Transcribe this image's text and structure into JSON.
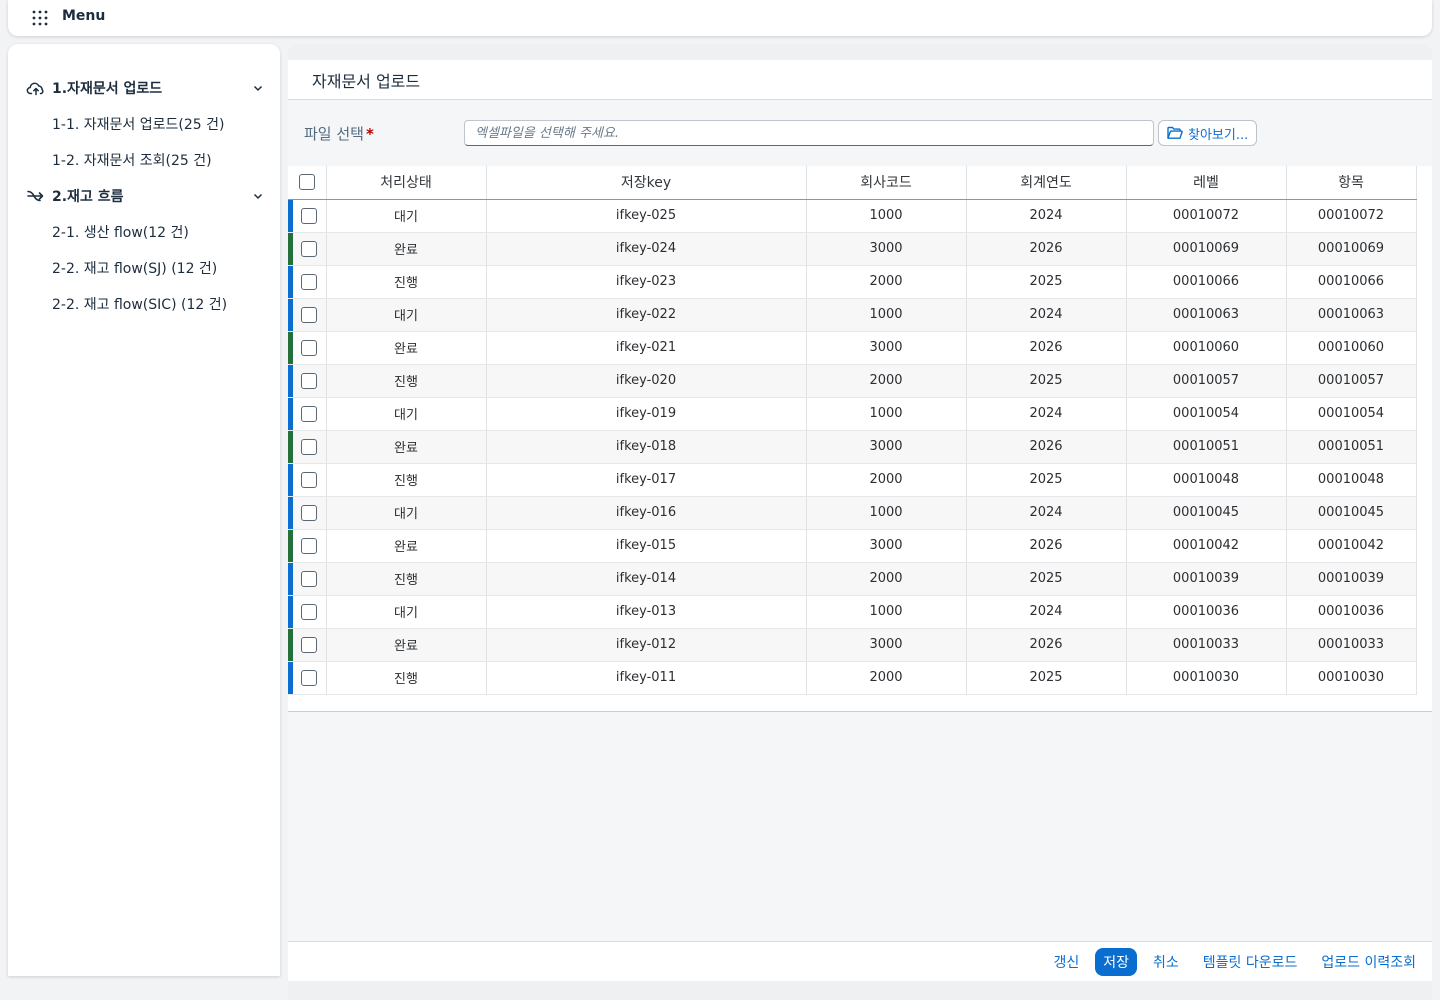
{
  "shell": {
    "menu_label": "Menu"
  },
  "sidebar": {
    "groups": [
      {
        "label": "1.자재문서 업로드",
        "icon": "cloud-upload-icon",
        "items": [
          {
            "label": "1-1. 자재문서 업로드(25 건)"
          },
          {
            "label": "1-2. 자재문서 조회(25 건)"
          }
        ]
      },
      {
        "label": "2.재고 흐름",
        "icon": "flow-arrow-icon",
        "items": [
          {
            "label": "2-1. 생산 flow(12 건)"
          },
          {
            "label": "2-2. 재고 flow(SJ) (12 건)"
          },
          {
            "label": "2-2. 재고 flow(SIC) (12 건)"
          }
        ]
      }
    ]
  },
  "main": {
    "title": "자재문서 업로드",
    "file_label": "파일 선택",
    "file_placeholder": "엑셀파일을 선택해 주세요.",
    "file_value": "",
    "browse_label": "찾아보기..."
  },
  "colors": {
    "accent": "#0a6ed1",
    "stripe_waiting": "#0a6ed1",
    "stripe_done": "#256f3a",
    "stripe_progress": "#0a6ed1"
  },
  "table": {
    "headers": [
      "처리상태",
      "저장key",
      "회사코드",
      "회계연도",
      "레벨",
      "항목"
    ],
    "rows": [
      {
        "status": "대기",
        "key": "ifkey-025",
        "company": "1000",
        "year": "2024",
        "level": "00010072",
        "item": "00010072"
      },
      {
        "status": "완료",
        "key": "ifkey-024",
        "company": "3000",
        "year": "2026",
        "level": "00010069",
        "item": "00010069"
      },
      {
        "status": "진행",
        "key": "ifkey-023",
        "company": "2000",
        "year": "2025",
        "level": "00010066",
        "item": "00010066"
      },
      {
        "status": "대기",
        "key": "ifkey-022",
        "company": "1000",
        "year": "2024",
        "level": "00010063",
        "item": "00010063"
      },
      {
        "status": "완료",
        "key": "ifkey-021",
        "company": "3000",
        "year": "2026",
        "level": "00010060",
        "item": "00010060"
      },
      {
        "status": "진행",
        "key": "ifkey-020",
        "company": "2000",
        "year": "2025",
        "level": "00010057",
        "item": "00010057"
      },
      {
        "status": "대기",
        "key": "ifkey-019",
        "company": "1000",
        "year": "2024",
        "level": "00010054",
        "item": "00010054"
      },
      {
        "status": "완료",
        "key": "ifkey-018",
        "company": "3000",
        "year": "2026",
        "level": "00010051",
        "item": "00010051"
      },
      {
        "status": "진행",
        "key": "ifkey-017",
        "company": "2000",
        "year": "2025",
        "level": "00010048",
        "item": "00010048"
      },
      {
        "status": "대기",
        "key": "ifkey-016",
        "company": "1000",
        "year": "2024",
        "level": "00010045",
        "item": "00010045"
      },
      {
        "status": "완료",
        "key": "ifkey-015",
        "company": "3000",
        "year": "2026",
        "level": "00010042",
        "item": "00010042"
      },
      {
        "status": "진행",
        "key": "ifkey-014",
        "company": "2000",
        "year": "2025",
        "level": "00010039",
        "item": "00010039"
      },
      {
        "status": "대기",
        "key": "ifkey-013",
        "company": "1000",
        "year": "2024",
        "level": "00010036",
        "item": "00010036"
      },
      {
        "status": "완료",
        "key": "ifkey-012",
        "company": "3000",
        "year": "2026",
        "level": "00010033",
        "item": "00010033"
      },
      {
        "status": "진행",
        "key": "ifkey-011",
        "company": "2000",
        "year": "2025",
        "level": "00010030",
        "item": "00010030"
      }
    ]
  },
  "footer": {
    "refresh": "갱신",
    "save": "저장",
    "cancel": "취소",
    "template_download": "템플릿 다운로드",
    "upload_history": "업로드 이력조회"
  }
}
